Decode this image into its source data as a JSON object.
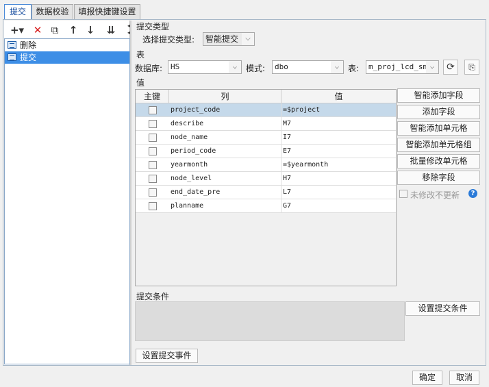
{
  "tabs": [
    {
      "label": "提交"
    },
    {
      "label": "数据校验"
    },
    {
      "label": "填报快捷键设置"
    }
  ],
  "toolbar": {
    "add_icon": "+▾",
    "delete_icon": "✕",
    "copy_icon": "⧉",
    "up_icon": "↑",
    "down_icon": "↓",
    "bottom_icon": "⇊"
  },
  "tree": {
    "items": [
      {
        "label": "删除",
        "selected": false
      },
      {
        "label": "提交",
        "selected": true
      }
    ]
  },
  "submit_type": {
    "section_title": "提交类型",
    "select_label": "选择提交类型:",
    "selected_value": "智能提交"
  },
  "table_section": {
    "section_title": "表",
    "db_label": "数据库:",
    "db_value": "HS",
    "schema_label": "模式:",
    "schema_value": "dbo",
    "table_label": "表:",
    "table_value": "m_proj_lcd_sm"
  },
  "values_section": {
    "section_title": "值",
    "headers": {
      "key": "主键",
      "column": "列",
      "value": "值"
    },
    "rows": [
      {
        "column": "project_code",
        "value": "=$project"
      },
      {
        "column": "describe",
        "value": "M7"
      },
      {
        "column": "node_name",
        "value": "I7"
      },
      {
        "column": "period_code",
        "value": "E7"
      },
      {
        "column": "yearmonth",
        "value": "=$yearmonth"
      },
      {
        "column": "node_level",
        "value": "H7"
      },
      {
        "column": "end_date_pre",
        "value": "L7"
      },
      {
        "column": "planname",
        "value": "G7"
      }
    ]
  },
  "side_buttons": {
    "smart_add_field": "智能添加字段",
    "add_field": "添加字段",
    "smart_add_cell": "智能添加单元格",
    "smart_add_cell_group": "智能添加单元格组",
    "batch_modify_cell": "批量修改单元格",
    "remove_field": "移除字段",
    "no_update_label": "未修改不更新",
    "help_icon": "?"
  },
  "conditions": {
    "section_title": "提交条件",
    "set_condition_button": "设置提交条件",
    "set_event_button": "设置提交事件"
  },
  "footer": {
    "ok_button": "确定",
    "cancel_button": "取消"
  },
  "colors": {
    "selected_tree": "#3d8ee6",
    "selected_row": "#c5d9ea",
    "delete_icon": "#d82020",
    "help_icon": "#2a7ad8"
  }
}
